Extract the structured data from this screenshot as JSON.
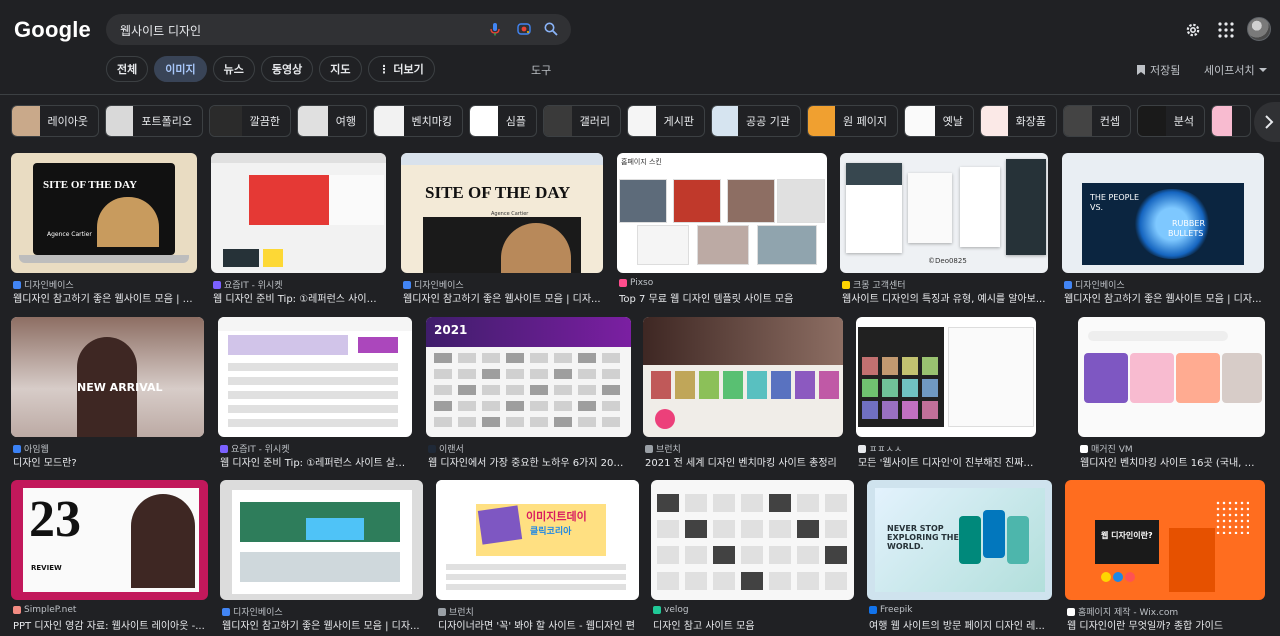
{
  "header": {
    "logo": "Google",
    "search_query": "웹사이트 디자인"
  },
  "tabs": [
    {
      "label": "전체",
      "active": false
    },
    {
      "label": "이미지",
      "active": true
    },
    {
      "label": "뉴스",
      "active": false
    },
    {
      "label": "동영상",
      "active": false
    },
    {
      "label": "지도",
      "active": false
    },
    {
      "label": "⋮ 더보기",
      "active": false
    }
  ],
  "tools_label": "도구",
  "saved_label": "저장됨",
  "safesearch_label": "세이프서치",
  "chips": [
    {
      "label": "레이아웃",
      "color": "#c9a98a"
    },
    {
      "label": "포트폴리오",
      "color": "#d9d9d9"
    },
    {
      "label": "깔끔한",
      "color": "#2b2b2b"
    },
    {
      "label": "여행",
      "color": "#e0e0e0"
    },
    {
      "label": "벤치마킹",
      "color": "#f2f2f2"
    },
    {
      "label": "심플",
      "color": "#ffffff"
    },
    {
      "label": "갤러리",
      "color": "#3a3a3a"
    },
    {
      "label": "게시판",
      "color": "#f5f5f5"
    },
    {
      "label": "공공 기관",
      "color": "#d6e4f0"
    },
    {
      "label": "원 페이지",
      "color": "#f0a030"
    },
    {
      "label": "옛날",
      "color": "#fafafa"
    },
    {
      "label": "화장품",
      "color": "#fbe9e7"
    },
    {
      "label": "컨셉",
      "color": "#444444"
    },
    {
      "label": "분석",
      "color": "#1a1a1a"
    },
    {
      "label": "",
      "color": "#f8bbd0"
    }
  ],
  "results": [
    {
      "source": "디자인베이스",
      "title": "웹디자인 참고하기 좋은 웹사이트 모음 | 디자...",
      "fav": "#4285f4",
      "bg": "#e9dcc2"
    },
    {
      "source": "요즘IT - 위시켓",
      "title": "웹 디자인 준비 Tip: ①레퍼런스 사이트 ...",
      "fav": "#7b61ff",
      "bg": "#f2f2f2"
    },
    {
      "source": "디자인베이스",
      "title": "웹디자인 참고하기 좋은 웹사이트 모음 | 디자...",
      "fav": "#4285f4",
      "bg": "#f3ead7"
    },
    {
      "source": "Pixso",
      "title": "Top 7 무료 웹 디자인 템플릿 사이트 모음",
      "fav": "#ff4d8d",
      "bg": "#ffffff"
    },
    {
      "source": "크몽 고객센터",
      "title": "웹사이트 디자인의 특징과 유형, 예시를 알아보...",
      "fav": "#ffd400",
      "bg": "#eef1f4"
    },
    {
      "source": "디자인베이스",
      "title": "웹디자인 참고하기 좋은 웹사이트 모음 | 디자...",
      "fav": "#4285f4",
      "bg": "#e9eef3"
    },
    {
      "source": "아임웹",
      "title": "디자인 모드란?",
      "fav": "#3b82f6",
      "bg": "#f6f6f6"
    },
    {
      "source": "요즘IT - 위시켓",
      "title": "웹 디자인 준비 Tip: ①레퍼런스 사이트 살펴...",
      "fav": "#7b61ff",
      "bg": "#ffffff"
    },
    {
      "source": "이랜서",
      "title": "웹 디자인에서 가장 중요한 노하우 6가지 202...",
      "fav": "#1f2937",
      "bg": "#f5f5f5"
    },
    {
      "source": "브런치",
      "title": "2021 전 세계 디자인 벤치마킹 사이트 총정리",
      "fav": "#9aa0a6",
      "bg": "#f0ede8"
    },
    {
      "source": "ㅍㅍㅅㅅ",
      "title": "모든 '웹사이트 디자인'이 진부해진 진짜 이유는...",
      "fav": "#e8eaed",
      "bg": "#ffffff"
    },
    {
      "source": "매거진 VM",
      "title": "웹디자인 벤치마킹 사이트 16곳 (국내, 해...",
      "fav": "#ffffff",
      "bg": "#fafafa"
    },
    {
      "source": "SimpleP.net",
      "title": "PPT 디자인 영감 자료: 웹사이트 레이아웃 -...",
      "fav": "#f28b82",
      "bg": "#c2185b"
    },
    {
      "source": "디자인베이스",
      "title": "웹디자인 참고하기 좋은 웹사이트 모음 | 디자...",
      "fav": "#4285f4",
      "bg": "#dcdcdc"
    },
    {
      "source": "브런치",
      "title": "디자이너라면 '꼭' 봐야 할 사이트 - 웹디자인 편",
      "fav": "#9aa0a6",
      "bg": "#ffffff"
    },
    {
      "source": "velog",
      "title": "디자인 참고 사이트 모음",
      "fav": "#20c997",
      "bg": "#f7f7f7"
    },
    {
      "source": "Freepik",
      "title": "여행 웹 사이트의 방문 페이지 디자인 레...",
      "fav": "#1273eb",
      "bg": "#cfe3ee"
    },
    {
      "source": "홈페이지 제작 - Wix.com",
      "title": "웹 디자인이란 무엇일까? 종합 가이드",
      "fav": "#ffffff",
      "bg": "#ff6d1f"
    }
  ],
  "thumb_texts": {
    "r0": "SITE OF THE DAY",
    "r0b": "Agence Cartier",
    "r2": "SITE OF THE DAY",
    "r2b": "Agence Cartier",
    "r3": "홈페이지 스킨",
    "r5a": "THE PEOPLE",
    "r5b": "VS.",
    "r5c": "RUBBER",
    "r5d": "BULLETS",
    "r6": "NEW ARRIVAL",
    "r8": "2021",
    "r12": "23",
    "r12b": "REVIEW",
    "r14a": "이미지트데이",
    "r14b": "클릭코리아",
    "r16a": "NEVER STOP",
    "r16b": "EXPLORING THE",
    "r16c": "WORLD.",
    "r17": "웹 디자인이란?",
    "r4w": "©Deo0825"
  }
}
